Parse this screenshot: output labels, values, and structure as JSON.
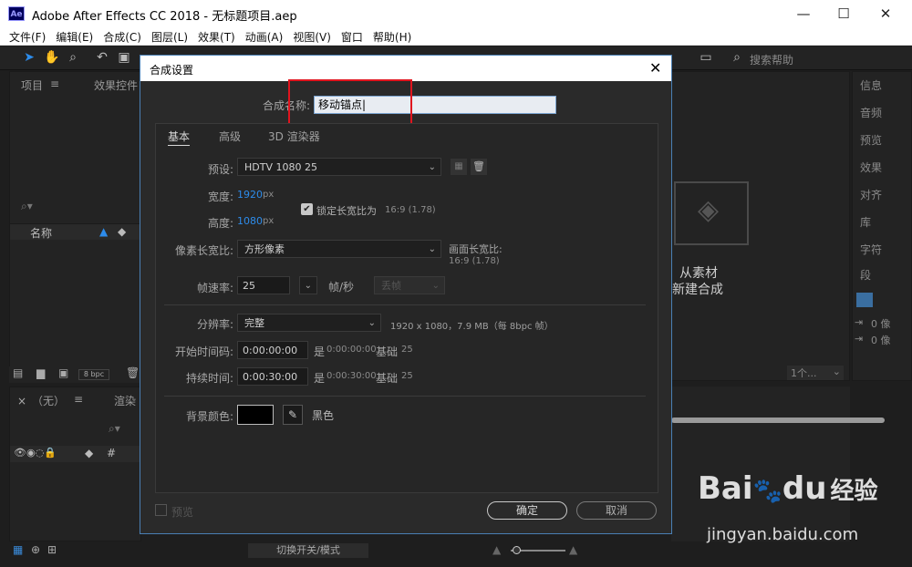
{
  "window": {
    "app_icon": "Ae",
    "title": "Adobe After Effects CC 2018 - 无标题项目.aep",
    "minimize": "—",
    "maximize": "☐",
    "close": "✕"
  },
  "menu": [
    "文件(F)",
    "编辑(E)",
    "合成(C)",
    "图层(L)",
    "效果(T)",
    "动画(A)",
    "视图(V)",
    "窗口",
    "帮助(H)"
  ],
  "toolbar": {
    "search_help": "搜索帮助"
  },
  "left_panel": {
    "tab_project": "项目",
    "tab_effects": "效果控件",
    "name_col": "名称",
    "bpc": "8 bpc",
    "timeline_tab": "（无）",
    "render_tab": "渲染"
  },
  "right_panel": {
    "items": [
      "信息",
      "音频",
      "预览",
      "效果",
      "对齐",
      "库",
      "字符",
      "段"
    ],
    "values": [
      "0 像",
      "0 像"
    ]
  },
  "comp_panel": {
    "new_from_footage_1": "从素材",
    "new_from_footage_2": "新建合成",
    "dropdown": "1个..."
  },
  "bottom_bar": {
    "toggle": "切换开关/模式"
  },
  "dialog": {
    "title": "合成设置",
    "name_label": "合成名称:",
    "name_value": "移动锚点",
    "tabs": [
      "基本",
      "高级",
      "3D 渲染器"
    ],
    "preset_label": "预设:",
    "preset_value": "HDTV 1080 25",
    "width_label": "宽度:",
    "width_value": "1920",
    "height_label": "高度:",
    "height_value": "1080",
    "unit": "px",
    "lock_label": "锁定长宽比为",
    "lock_ratio": "16:9 (1.78)",
    "pixel_ratio_label": "像素长宽比:",
    "pixel_ratio_value": "方形像素",
    "frame_ratio_label": "画面长宽比:",
    "frame_ratio_value": "16:9 (1.78)",
    "framerate_label": "帧速率:",
    "framerate_value": "25",
    "framerate_unit": "帧/秒",
    "drop_frame": "丢帧",
    "resolution_label": "分辨率:",
    "resolution_value": "完整",
    "resolution_info": "1920 x 1080，7.9 MB（每 8bpc 帧）",
    "start_label": "开始时间码:",
    "start_value": "0:00:00:00",
    "start_is": "是",
    "start_tc": "0:00:00:00",
    "base_label": "基础",
    "base_value": "25",
    "duration_label": "持续时间:",
    "duration_value": "0:00:30:00",
    "duration_is": "是",
    "duration_tc": "0:00:30:00",
    "bg_label": "背景颜色:",
    "bg_color": "#000000",
    "bg_name": "黑色",
    "preview": "预览",
    "ok": "确定",
    "cancel": "取消"
  },
  "watermark": {
    "brand": "Bai",
    "brand2": "du",
    "jingyan": "经验",
    "url": "jingyan.baidu.com"
  },
  "colors": {
    "accent_blue": "#2d8ceb",
    "highlight_red": "#e0141e"
  }
}
